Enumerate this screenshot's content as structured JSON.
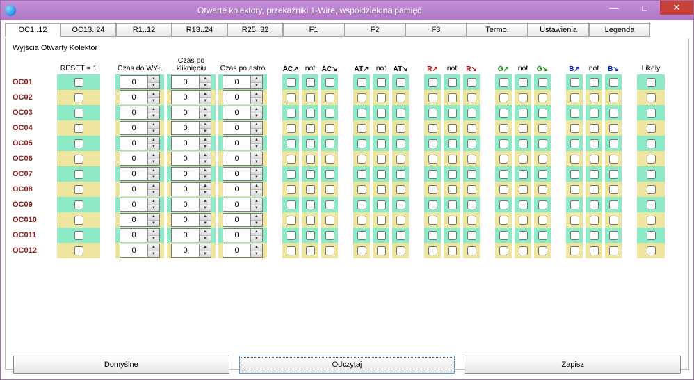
{
  "window": {
    "title": "Otwarte kolektory, przekaźniki 1-Wire, współdzielona pamięć"
  },
  "tabs": [
    "OC1..12",
    "OC13..24",
    "R1..12",
    "R13..24",
    "R25..32",
    "F1",
    "F2",
    "F3",
    "Termo.",
    "Ustawienia",
    "Legenda"
  ],
  "section_title": "Wyjścia Otwarty Kolektor",
  "headers": {
    "reset": "RESET = 1",
    "czas_wyl": "Czas do WYŁ",
    "czas_klik": "Czas po kliknięciu",
    "czas_astro": "Czas po astro",
    "ac_up": "AC↗",
    "not1": "not",
    "ac_dn": "AC↘",
    "at_up": "AT↗",
    "not2": "not",
    "at_dn": "AT↘",
    "r_up": "R↗",
    "not3": "not",
    "r_dn": "R↘",
    "g_up": "G↗",
    "not4": "not",
    "g_dn": "G↘",
    "b_up": "B↗",
    "not5": "not",
    "b_dn": "B↘",
    "likely": "Likely"
  },
  "rows": [
    {
      "label": "OC01",
      "reset": false,
      "t1": 0,
      "t2": 0,
      "t3": 0
    },
    {
      "label": "OC02",
      "reset": false,
      "t1": 0,
      "t2": 0,
      "t3": 0
    },
    {
      "label": "OC03",
      "reset": false,
      "t1": 0,
      "t2": 0,
      "t3": 0
    },
    {
      "label": "OC04",
      "reset": false,
      "t1": 0,
      "t2": 0,
      "t3": 0
    },
    {
      "label": "OC05",
      "reset": false,
      "t1": 0,
      "t2": 0,
      "t3": 0
    },
    {
      "label": "OC06",
      "reset": false,
      "t1": 0,
      "t2": 0,
      "t3": 0
    },
    {
      "label": "OC07",
      "reset": false,
      "t1": 0,
      "t2": 0,
      "t3": 0
    },
    {
      "label": "OC08",
      "reset": false,
      "t1": 0,
      "t2": 0,
      "t3": 0
    },
    {
      "label": "OC09",
      "reset": false,
      "t1": 0,
      "t2": 0,
      "t3": 0
    },
    {
      "label": "OC010",
      "reset": false,
      "t1": 0,
      "t2": 0,
      "t3": 0
    },
    {
      "label": "OC011",
      "reset": false,
      "t1": 0,
      "t2": 0,
      "t3": 0
    },
    {
      "label": "OC012",
      "reset": false,
      "t1": 0,
      "t2": 0,
      "t3": 0
    }
  ],
  "footer": {
    "defaults": "Domyślne",
    "read": "Odczytaj",
    "save": "Zapisz"
  },
  "winbtns": {
    "min": "—",
    "max": "□",
    "close": "✕"
  }
}
